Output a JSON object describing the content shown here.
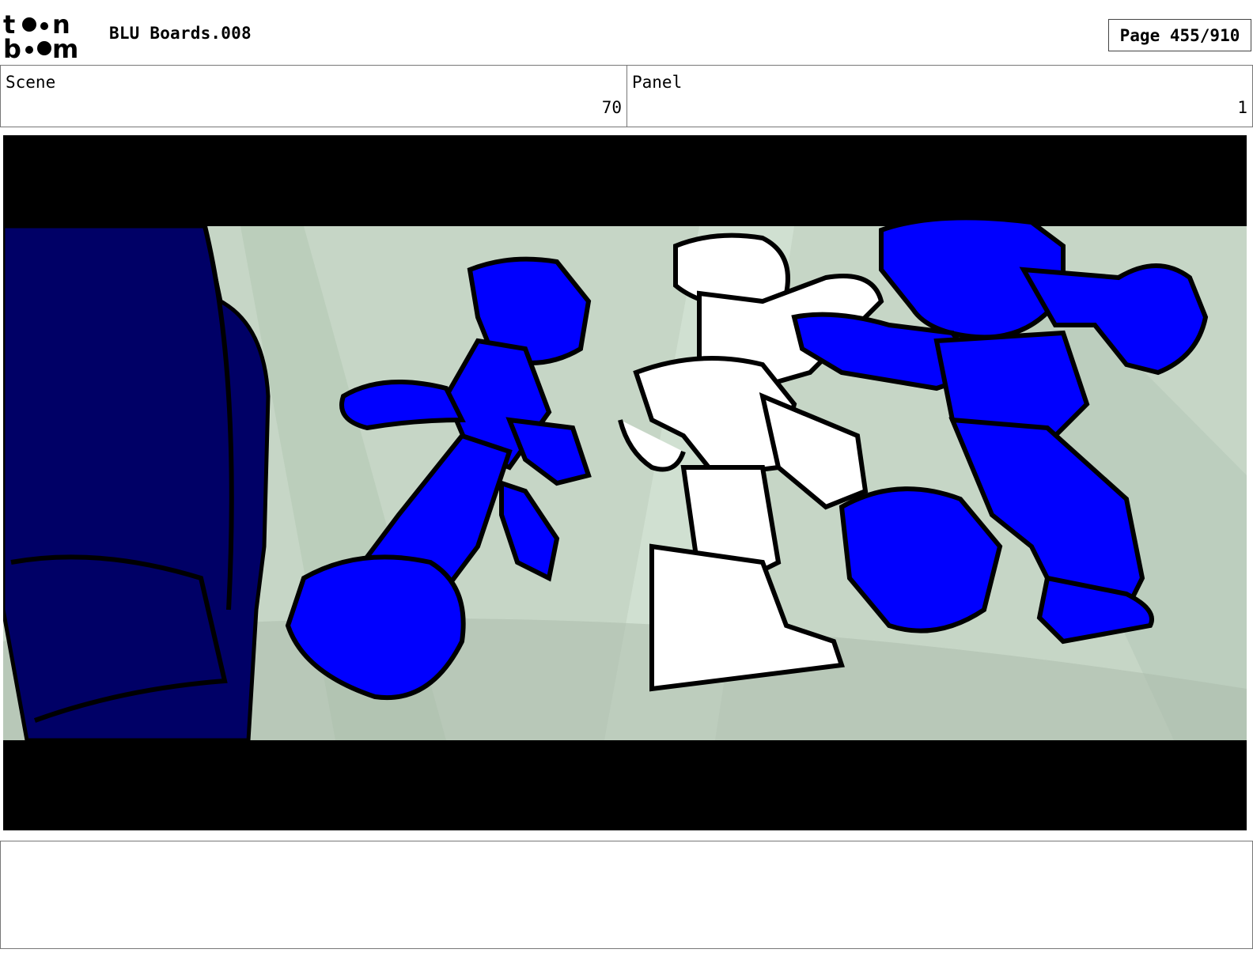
{
  "header": {
    "logo_text": "toon boom",
    "title": "BLU Boards.008",
    "page_label": "Page 455/910"
  },
  "info": {
    "scene_label": "Scene",
    "scene_value": "70",
    "panel_label": "Panel",
    "panel_value": "1"
  },
  "colors": {
    "blue_character": "#0000ff",
    "navy_foreground": "#000066",
    "background_mint": "#c6d6c6",
    "letterbox": "#000000"
  },
  "notes": {
    "text": ""
  }
}
